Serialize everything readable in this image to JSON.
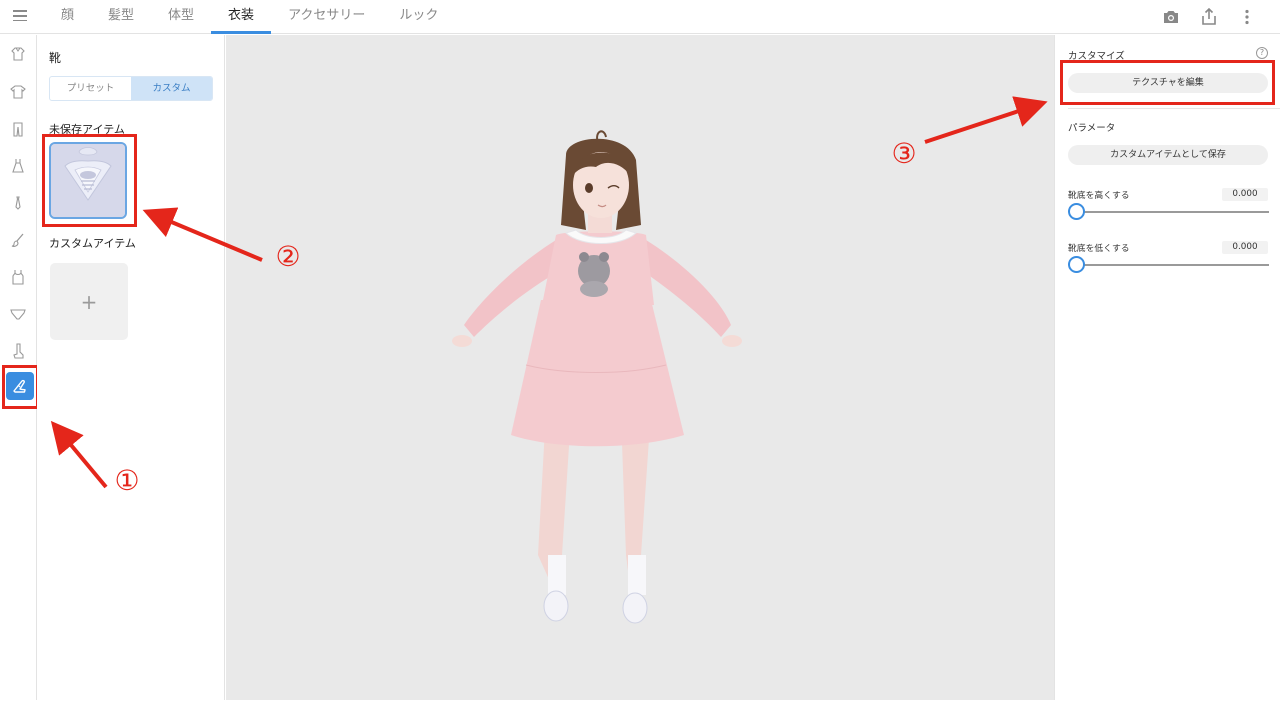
{
  "tabs": [
    {
      "label": "顔",
      "active": false
    },
    {
      "label": "髪型",
      "active": false
    },
    {
      "label": "体型",
      "active": false
    },
    {
      "label": "衣装",
      "active": true
    },
    {
      "label": "アクセサリー",
      "active": false
    },
    {
      "label": "ルック",
      "active": false
    }
  ],
  "top_icons": [
    "camera-icon",
    "share-icon",
    "more-vertical-icon"
  ],
  "rail_icons": [
    "shirt-icon",
    "tshirt-icon",
    "pants-icon",
    "dress-icon",
    "necktie-icon",
    "brush-icon",
    "tanktop-icon",
    "underwear-icon",
    "sock-icon",
    "shoe-icon"
  ],
  "panel": {
    "title": "靴",
    "segment": {
      "preset": "プリセット",
      "custom": "カスタム",
      "selected": "custom"
    },
    "unsaved_label": "未保存アイテム",
    "custom_label": "カスタムアイテム",
    "add_symbol": "+"
  },
  "right": {
    "customize_title": "カスタマイズ",
    "help_symbol": "?",
    "edit_texture": "テクスチャを編集",
    "params_title": "パラメータ",
    "save_custom": "カスタムアイテムとして保存",
    "sliders": [
      {
        "label": "靴底を高くする",
        "value": "0.000"
      },
      {
        "label": "靴底を低くする",
        "value": "0.000"
      }
    ]
  },
  "annotations": {
    "one": "①",
    "two": "②",
    "three": "③",
    "color": "#e4261b"
  }
}
